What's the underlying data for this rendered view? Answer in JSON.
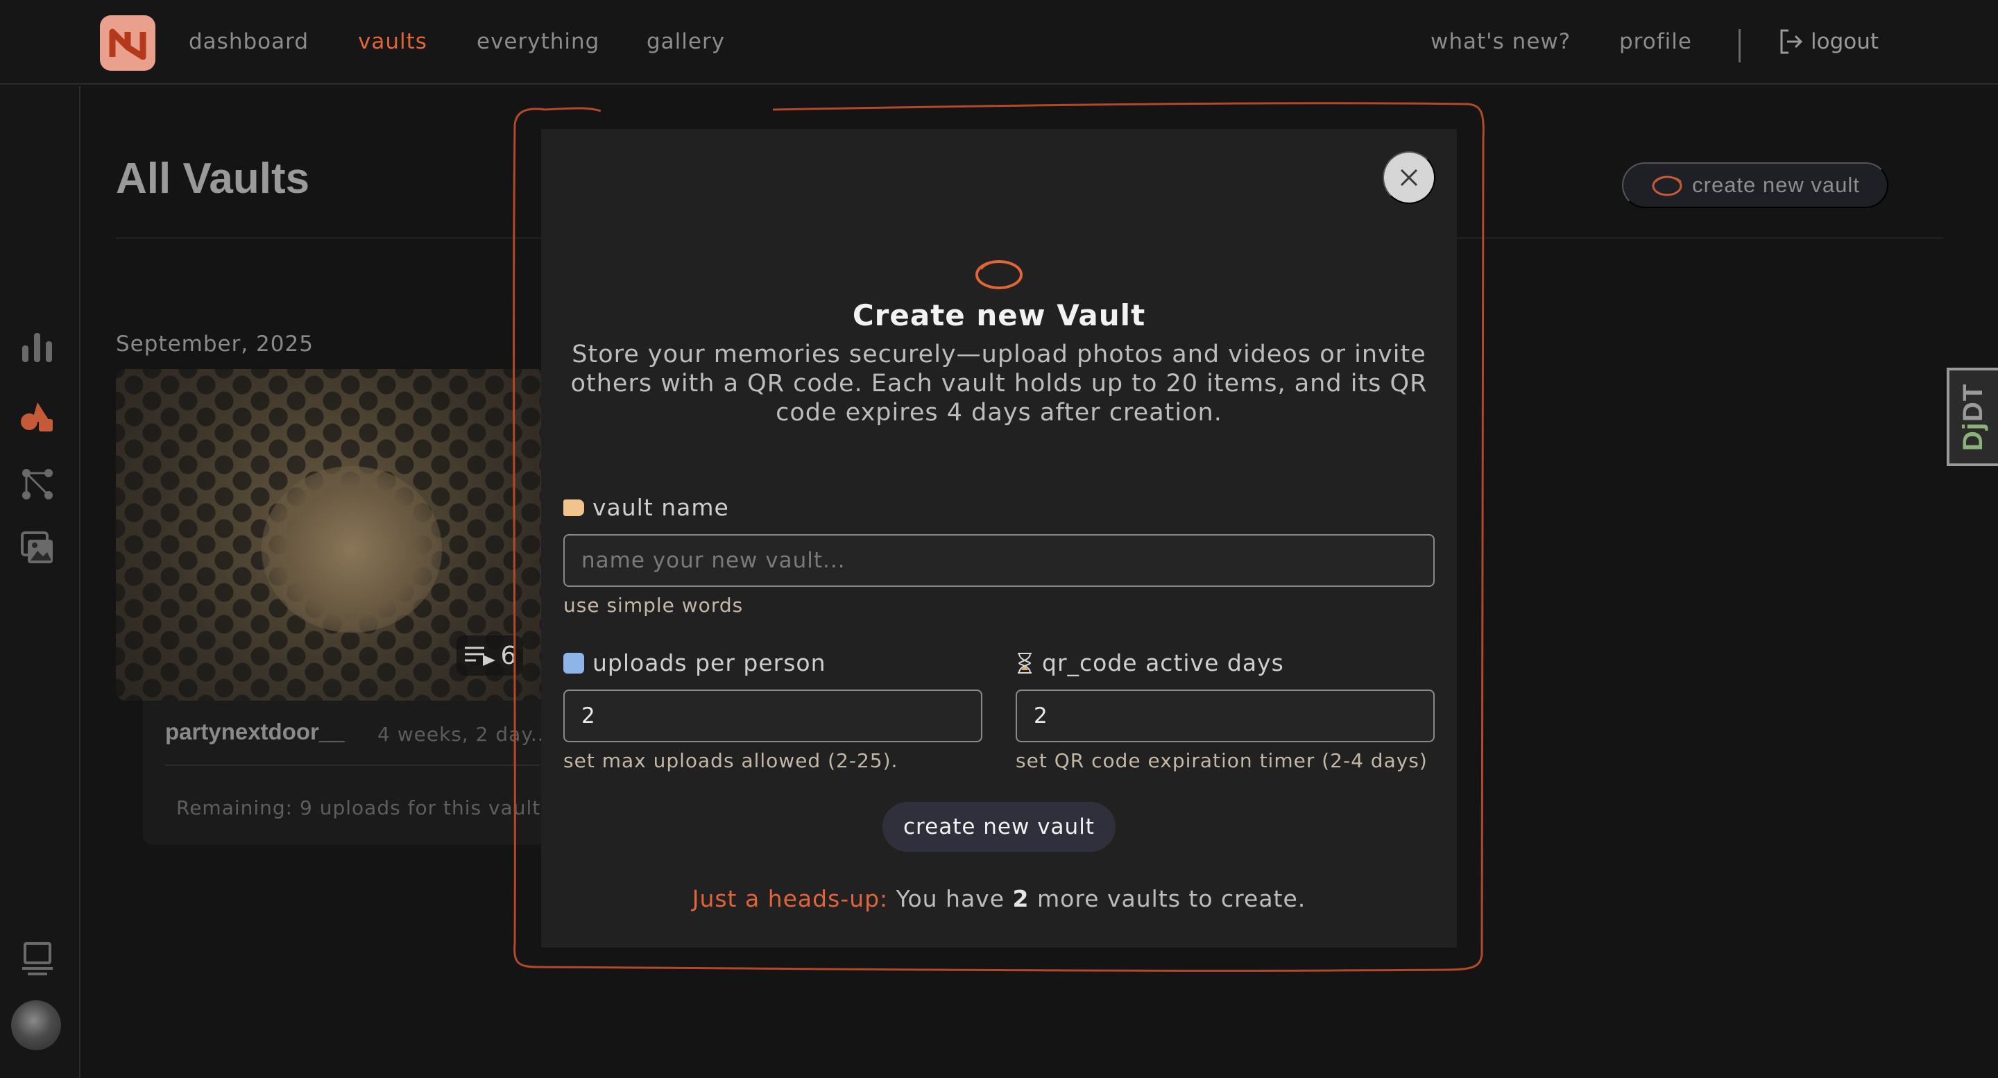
{
  "nav": {
    "links": [
      "dashboard",
      "vaults",
      "everything",
      "gallery"
    ],
    "active": "vaults",
    "right_links": [
      "what's new?",
      "profile"
    ],
    "logout_label": "logout"
  },
  "page": {
    "title": "All Vaults",
    "create_button_label": "create new vault",
    "month_label": "September, 2025"
  },
  "vault_card": {
    "item_count": "6",
    "owner": "partynextdoor__",
    "age": "4 weeks, 2 day...",
    "remaining": "Remaining: 9 uploads for this vault"
  },
  "debug_toolbar": {
    "label_prefix": "Dj",
    "label_suffix": "DT"
  },
  "modal": {
    "title": "Create new Vault",
    "description": "Store your memories securely—upload photos and videos or invite others with a QR code. Each vault holds up to 20 items, and its QR code expires 4 days after creation.",
    "vault_name": {
      "label": "vault name",
      "placeholder": "name your new vault...",
      "help": "use simple words"
    },
    "uploads_per_person": {
      "label": "uploads per person",
      "value": "2",
      "help": "set max uploads allowed (2-25)."
    },
    "qr_active_days": {
      "label": "qr_code active days",
      "value": "2",
      "help": "set QR code expiration timer (2-4 days)"
    },
    "submit_label": "create new vault",
    "headsup": {
      "highlight": "Just a heads-up:",
      "prefix": "You have",
      "count": "2",
      "suffix": "more vaults to create."
    }
  },
  "colors": {
    "accent": "#e2643a",
    "background": "#141414",
    "modal": "#212121"
  },
  "icons": {
    "sidebar": [
      "bar-chart-icon",
      "shapes-icon",
      "graph-icon",
      "gallery-icon"
    ],
    "sidebar_bottom": [
      "laptop-icon",
      "avatar"
    ]
  }
}
